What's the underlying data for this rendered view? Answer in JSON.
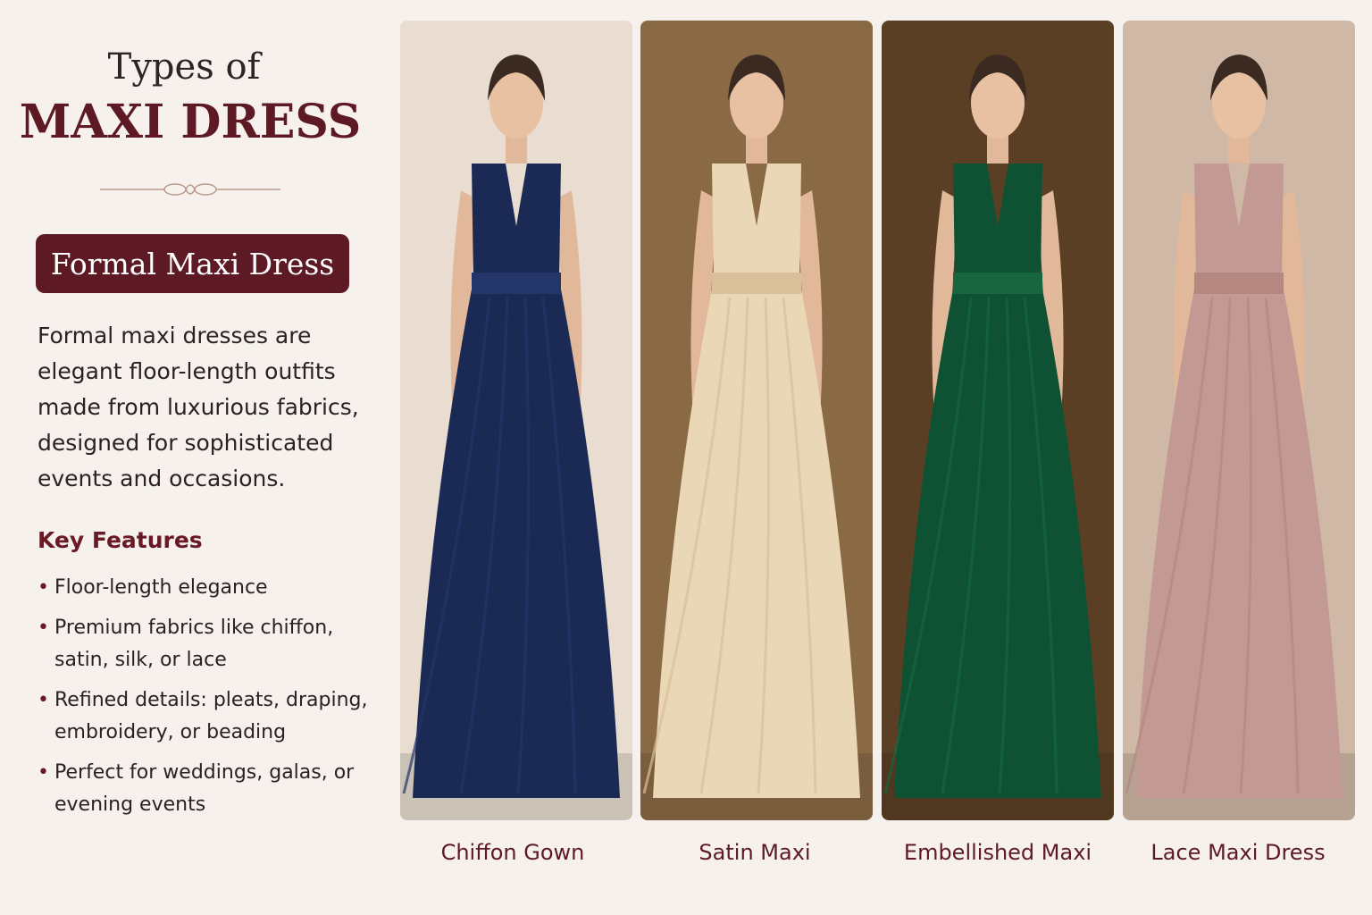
{
  "heading": {
    "line1": "Types of",
    "line2": "MAXI DRESS"
  },
  "section": {
    "badge": "Formal Maxi Dress",
    "description": "Formal maxi dresses are elegant floor-length outfits made from luxurious fabrics, designed for sophisticated events and occasions.",
    "features_title": "Key Features",
    "features": [
      "Floor-length elegance",
      "Premium fabrics like chiffon, satin, silk, or lace",
      "Refined details: pleats, draping, embroidery, or beading",
      "Perfect for weddings, galas, or evening events"
    ]
  },
  "dresses": [
    {
      "caption": "Chiffon Gown",
      "bg": "#e8ddd0",
      "dress": "#1b2a55",
      "accent": "#24356a"
    },
    {
      "caption": "Satin Maxi",
      "bg": "#8a6a45",
      "dress": "#ead7b6",
      "accent": "#d9c09a"
    },
    {
      "caption": "Embellished Maxi",
      "bg": "#5a3f25",
      "dress": "#0f5233",
      "accent": "#176640"
    },
    {
      "caption": "Lace Maxi Dress",
      "bg": "#cfb9a6",
      "dress": "#c39a93",
      "accent": "#b48780"
    }
  ],
  "colors": {
    "brand": "#5e1a24",
    "page_bg": "#f6f1ec"
  },
  "icons": {
    "divider": "ornament-divider-icon"
  }
}
